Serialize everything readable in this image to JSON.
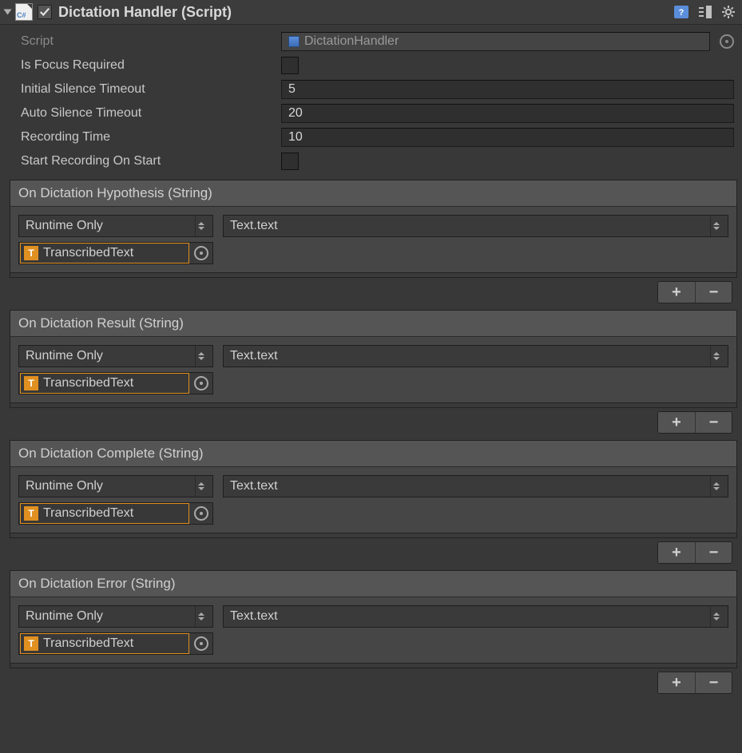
{
  "component": {
    "title": "Dictation Handler (Script)",
    "enabled": true,
    "scriptIcon": "C#"
  },
  "properties": {
    "script": {
      "label": "Script",
      "value": "DictationHandler"
    },
    "isFocusRequired": {
      "label": "Is Focus Required",
      "value": false
    },
    "initialSilenceTimeout": {
      "label": "Initial Silence Timeout",
      "value": "5"
    },
    "autoSilenceTimeout": {
      "label": "Auto Silence Timeout",
      "value": "20"
    },
    "recordingTime": {
      "label": "Recording Time",
      "value": "10"
    },
    "startRecordingOnStart": {
      "label": "Start Recording On Start",
      "value": false
    }
  },
  "events": [
    {
      "title": "On Dictation Hypothesis (String)",
      "callMode": "Runtime Only",
      "function": "Text.text",
      "target": "TranscribedText"
    },
    {
      "title": "On Dictation Result (String)",
      "callMode": "Runtime Only",
      "function": "Text.text",
      "target": "TranscribedText"
    },
    {
      "title": "On Dictation Complete (String)",
      "callMode": "Runtime Only",
      "function": "Text.text",
      "target": "TranscribedText"
    },
    {
      "title": "On Dictation Error (String)",
      "callMode": "Runtime Only",
      "function": "Text.text",
      "target": "TranscribedText"
    }
  ],
  "buttons": {
    "plus": "+",
    "minus": "−"
  },
  "textIconGlyph": "T"
}
